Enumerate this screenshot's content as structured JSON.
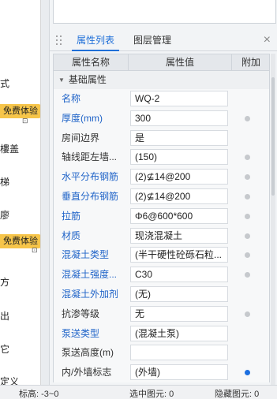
{
  "left_menu": {
    "items": [
      {
        "label": "式"
      },
      {
        "label": "樓盖"
      },
      {
        "label": "梯"
      },
      {
        "label": "廖"
      },
      {
        "label": "方"
      },
      {
        "label": "出"
      },
      {
        "label": "它"
      },
      {
        "label": "定义"
      }
    ],
    "badges": [
      {
        "label": "免费体验"
      },
      {
        "label": "免费体验"
      }
    ]
  },
  "panel": {
    "tabs": [
      {
        "label": "属性列表"
      },
      {
        "label": "图层管理"
      }
    ],
    "close_glyph": "×",
    "columns": {
      "name": "属性名称",
      "value": "属性值",
      "extra": "附加"
    },
    "group": {
      "label": "基础属性"
    },
    "rows": [
      {
        "name": "名称",
        "value": "WQ-2",
        "blue": true,
        "dot": "none"
      },
      {
        "name": "厚度(mm)",
        "value": "300",
        "blue": true,
        "dot": "gray"
      },
      {
        "name": "房间边界",
        "value": "是",
        "blue": false,
        "dot": "none"
      },
      {
        "name": "轴线距左墙...",
        "value": "(150)",
        "blue": false,
        "dot": "gray"
      },
      {
        "name": "水平分布钢筋",
        "value": "(2)⊈14@200",
        "blue": true,
        "dot": "gray"
      },
      {
        "name": "垂直分布钢筋",
        "value": "(2)⊈14@200",
        "blue": true,
        "dot": "gray"
      },
      {
        "name": "拉筋",
        "value": "Φ6@600*600",
        "blue": true,
        "dot": "gray"
      },
      {
        "name": "材质",
        "value": "现浇混凝土",
        "blue": true,
        "dot": "gray"
      },
      {
        "name": "混凝土类型",
        "value": "(半干硬性砼砾石粒...",
        "blue": true,
        "dot": "gray"
      },
      {
        "name": "混凝土强度...",
        "value": "C30",
        "blue": true,
        "dot": "gray"
      },
      {
        "name": "混凝土外加剂",
        "value": "(无)",
        "blue": true,
        "dot": "none"
      },
      {
        "name": "抗渗等级",
        "value": "无",
        "blue": false,
        "dot": "gray"
      },
      {
        "name": "泵送类型",
        "value": "(混凝土泵)",
        "blue": true,
        "dot": "none"
      },
      {
        "name": "泵送高度(m)",
        "value": "",
        "blue": false,
        "dot": "none"
      },
      {
        "name": "内/外墙标志",
        "value": "(外墙)",
        "blue": false,
        "dot": "blue"
      }
    ]
  },
  "statusbar": {
    "elevation": "标高:  -3~0",
    "selected": "选中图元:  0",
    "hidden": "隐藏图元:  0"
  },
  "colors": {
    "accent": "#1f6fd8",
    "badge": "#f6c54a",
    "label_blue": "#1f63c8"
  }
}
